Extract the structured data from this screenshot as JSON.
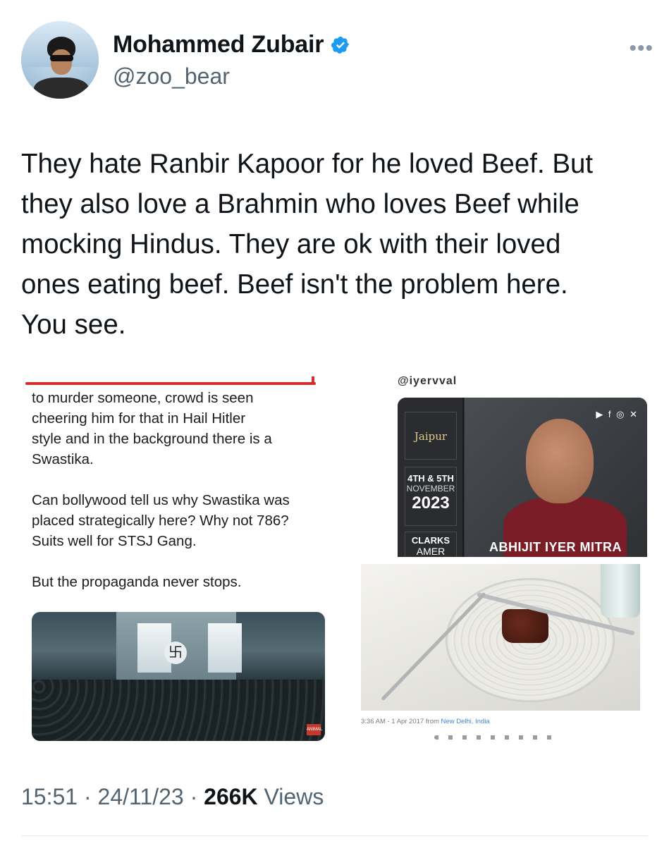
{
  "author": {
    "display_name": "Mohammed Zubair",
    "handle": "@zoo_bear",
    "verified_color": "#1d9bf0"
  },
  "more_icon": "ellipsis-icon",
  "tweet": {
    "text": "They hate Ranbir Kapoor for he loved Beef. But\nthey also love a Brahmin who loves Beef while\nmocking Hindus. They are ok with their loved\nones eating beef. Beef isn't the problem here.\nYou see."
  },
  "media": {
    "left_quote": "to murder someone, crowd is seen\ncheering him for that in Hail Hitler\nstyle and in the background there is a\nSwastika.\n\nCan bollywood tell us why Swastika was\nplaced strategically here? Why not 786?\nSuits well for STSJ Gang.\n\nBut the propaganda never stops.",
    "crowd_emblem": "卐",
    "crowd_logo": "ANIMAL",
    "handle_cut": "@iyervval",
    "promo": {
      "brand": "Jaipur",
      "date_line1": "4TH & 5TH",
      "date_line2": "NOVEMBER",
      "date_year": "2023",
      "venue_line1": "CLARKS",
      "venue_line2": "AMER",
      "person_name": "ABHIJIT IYER MITRA",
      "socials": "▶ f ◎ ✕"
    },
    "food_timestamp": "3:36 AM - 1 Apr 2017 from ",
    "food_location": "New Delhi, India"
  },
  "meta": {
    "time": "15:51",
    "date": "24/11/23",
    "separator": " · ",
    "views_count": "266K",
    "views_label": " Views"
  }
}
